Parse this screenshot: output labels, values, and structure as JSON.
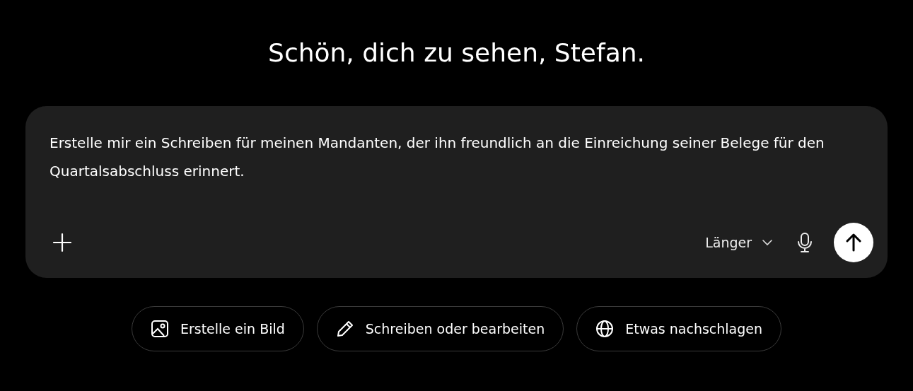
{
  "greeting": "Schön, dich zu sehen, Stefan.",
  "composer": {
    "value": "Erstelle mir ein Schreiben für meinen Mandanten, der ihn freundlich an die Einreichung seiner Belege für den Quartalsabschluss erinnert.",
    "length_option": "Länger"
  },
  "suggestions": [
    {
      "kind": "image",
      "label": "Erstelle ein Bild"
    },
    {
      "kind": "pencil",
      "label": "Schreiben oder bearbeiten"
    },
    {
      "kind": "globe",
      "label": "Etwas nachschlagen"
    }
  ]
}
